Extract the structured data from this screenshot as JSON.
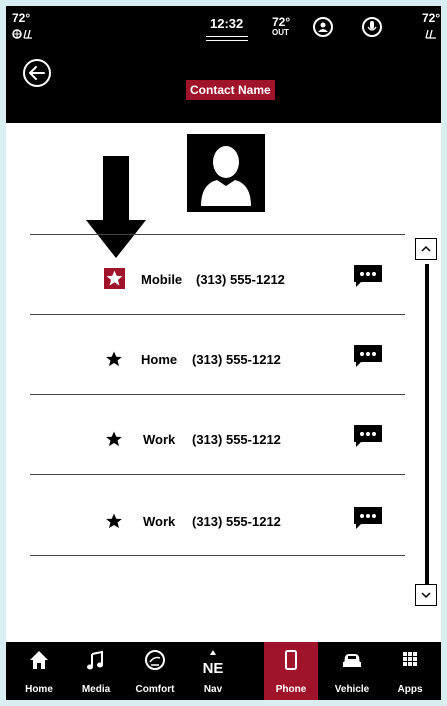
{
  "status": {
    "temp_left": "72°",
    "clock": "12:32",
    "temp_out": "72°",
    "out_label": "OUT",
    "temp_right": "72°"
  },
  "header": {
    "title": "Contact Name"
  },
  "contacts": [
    {
      "type": "Mobile",
      "number": "(313) 555-1212",
      "favorite": true
    },
    {
      "type": "Home",
      "number": "(313) 555-1212",
      "favorite": false
    },
    {
      "type": "Work",
      "number": "(313) 555-1212",
      "favorite": false
    },
    {
      "type": "Work",
      "number": "(313) 555-1212",
      "favorite": false
    }
  ],
  "nav": {
    "items": [
      {
        "label": "Home",
        "icon": "home-icon"
      },
      {
        "label": "Media",
        "icon": "music-note-icon"
      },
      {
        "label": "Comfort",
        "icon": "climate-icon"
      },
      {
        "label": "Nav",
        "icon": "compass-icon",
        "heading": "NE"
      },
      {
        "label": "Phone",
        "icon": "phone-icon",
        "active": true
      },
      {
        "label": "Vehicle",
        "icon": "car-icon"
      },
      {
        "label": "Apps",
        "icon": "apps-grid-icon"
      }
    ]
  },
  "colors": {
    "accent": "#a0142b",
    "bar": "#000000",
    "background": "#ffffff",
    "frame": "#d8eef0"
  }
}
